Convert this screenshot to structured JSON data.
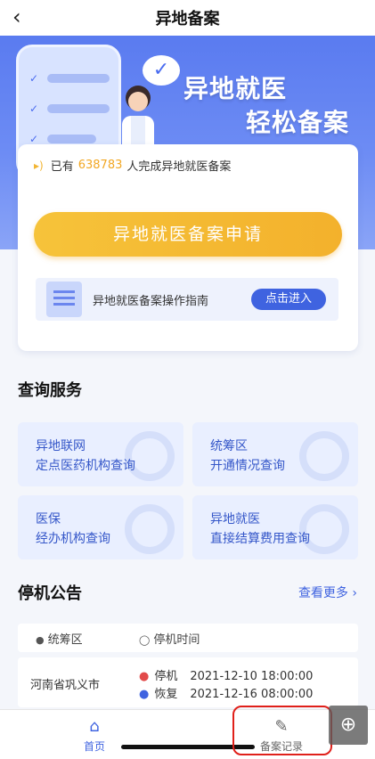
{
  "header": {
    "title": "异地备案",
    "back_icon": "chevron-left-icon"
  },
  "banner": {
    "line1": "异地就医",
    "line2": "轻松备案",
    "bubble_icon": "check-bubble-icon"
  },
  "stats": {
    "prefix": "已有",
    "count": "638783",
    "suffix": "人完成异地就医备案",
    "icon": "speaker-icon"
  },
  "apply_button": "异地就医备案申请",
  "guide": {
    "label": "异地就医备案操作指南",
    "button": "点击进入"
  },
  "query": {
    "title": "查询服务",
    "items": [
      {
        "line1": "异地联网",
        "line2": "定点医药机构查询"
      },
      {
        "line1": "统筹区",
        "line2": "开通情况查询"
      },
      {
        "line1": "医保",
        "line2": "经办机构查询"
      },
      {
        "line1": "异地就医",
        "line2": "直接结算费用查询"
      }
    ]
  },
  "notice": {
    "title": "停机公告",
    "more": "查看更多",
    "col_region": "统筹区",
    "col_time": "停机时间",
    "rows": [
      {
        "region": "河南省巩义市",
        "stop_label": "停机",
        "stop_time": "2021-12-10 18:00:00",
        "resume_label": "恢复",
        "resume_time": "2021-12-16 08:00:00"
      }
    ]
  },
  "tabs": {
    "home": "首页",
    "records": "备案记录"
  },
  "colors": {
    "accent": "#3f63e0",
    "cta": "#f3b12c",
    "highlight": "#e0201a"
  }
}
